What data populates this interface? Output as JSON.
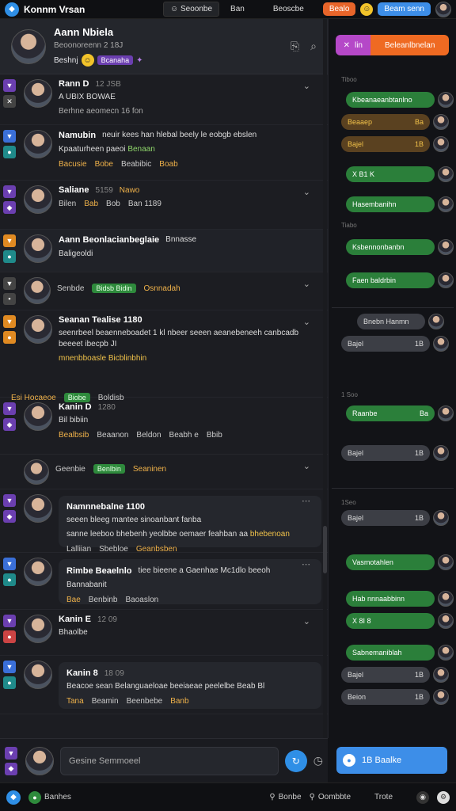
{
  "topbar": {
    "title": "Konnm Vrsan",
    "tabs": [
      "Seoonbe",
      "Ban",
      "Beoscbe"
    ],
    "btn_orange": "Bealo",
    "btn_blue": "Beam senn"
  },
  "channel": {
    "name": "Aann Nbiela",
    "subtitle": "Beoonoreenn 2 18J",
    "status": "Beshnj",
    "tag": "Bcanaha"
  },
  "messages": [
    {
      "name": "Rann D",
      "time": "12 JSB",
      "text": "A UBIX BOWAE",
      "sub": "Berhne aeomecn 16 fon",
      "reacts": []
    },
    {
      "name": "Namubin",
      "time": "",
      "text": "neuir kees han hlebal beely le eobgb ebslen",
      "text2": "Kpaaturheen paeoi",
      "text3": "Benaan",
      "reacts": [
        "Bacusie",
        "Bobe",
        "Beabibic",
        "Boab"
      ]
    },
    {
      "name": "Saliane",
      "time": "5159",
      "time2": "Nawo",
      "text": "",
      "reacts": [
        "Bilen",
        "Bab",
        "Bob",
        "Ban 1189"
      ]
    },
    {
      "name": "Aann Beonlacianbeglaie",
      "time": "",
      "text": "Bnnasse",
      "text2": "Baligeoldi",
      "reacts": []
    },
    {
      "name": "",
      "time": "",
      "text": "",
      "reacts": [
        "Senbde",
        "Bidsb Bidin",
        "Osnnadah"
      ]
    },
    {
      "name": "Seanan Tealise 1180",
      "time": "",
      "text": "seenrbeel beaenneboadet 1 kl nbeer seeen aeanebeneeh canbcadb beeeet ibecpb JI",
      "text2": "mnenbboasle",
      "text3": "Bicblinbhin",
      "reacts": []
    },
    {
      "name": "",
      "time": "",
      "text": "",
      "reacts": [
        "Esi Hocaeoe",
        "Biobe",
        "Boldisb"
      ]
    },
    {
      "name": "Kanin D",
      "time": "1280",
      "text": "Bil bibiin",
      "reacts": [
        "Bealbsib",
        "Beaanon",
        "Beldon",
        "Beabh e",
        "Bbib"
      ]
    },
    {
      "name": "",
      "time": "",
      "text": "",
      "reacts": [
        "Geenbie",
        "Benlbin",
        "Seaninen"
      ]
    },
    {
      "name": "Namnnebalne 1100",
      "time": "",
      "text": "seeen bleeg mantee sinoanbant fanba",
      "text2": "sanne leeboo bhebenh yeolbbe oemaer feahban aa",
      "text3": "bhebenoan",
      "reacts": [
        "Lalliian",
        "Sbebloe",
        "Geanbsben"
      ]
    },
    {
      "name": "Rimbe Beaelnlo",
      "time": "",
      "text": "tiee bieene a Gaenhae Mc1dlo beeoh",
      "text2": "Bannabanit",
      "reacts": [
        "Bae",
        "Benbinb",
        "Baoaslon"
      ]
    },
    {
      "name": "Kanin E",
      "time": "12 09",
      "text": "Bhaolbe",
      "reacts": []
    },
    {
      "name": "Kanin 8",
      "time": "18 09",
      "text": "Beacoe sean Belanguaeloae beeiaeae peelelbe Beab Bl",
      "reacts": [
        "Tana",
        "Beamin",
        "Beenbebe",
        "Banb"
      ]
    }
  ],
  "compose": {
    "placeholder": "Gesine Semmoeel"
  },
  "right": {
    "header_x": "lin",
    "header_btn": "Beleanlbnelan",
    "times": [
      "Tiboo",
      "Tiabo",
      "1 Soo",
      "1Seo"
    ],
    "rows": [
      {
        "label": "Kbeanaeanbtanlno",
        "style": "green"
      },
      {
        "label": "Beaaep",
        "num": "Ba",
        "style": "brown"
      },
      {
        "label": "Bajel",
        "num": "1B",
        "style": "brown"
      },
      {
        "label": "X B1 K",
        "style": "green"
      },
      {
        "label": "Hasembanihn",
        "style": "green"
      },
      {
        "label": "Ksbennonbanbn",
        "style": "green"
      },
      {
        "label": "Faen baldrbin",
        "style": "green"
      },
      {
        "label": "Bnebn Hanmn",
        "style": "gray"
      },
      {
        "label": "Bajel",
        "num": "1B",
        "style": "gray"
      },
      {
        "label": "Raanbe",
        "num": "Ba",
        "style": "green"
      },
      {
        "label": "Bajel",
        "num": "1B",
        "style": "gray"
      },
      {
        "label": "Bajel",
        "num": "1B",
        "style": "gray"
      },
      {
        "label": "Vasmotahlen",
        "style": "green"
      },
      {
        "label": "Hab nnnaabbinn",
        "style": "green"
      },
      {
        "label": "X 8I 8",
        "style": "green"
      },
      {
        "label": "Sabnemaniblah",
        "style": "green"
      },
      {
        "label": "Bajel",
        "num": "1B",
        "style": "gray"
      },
      {
        "label": "Beion",
        "num": "1B",
        "style": "gray"
      }
    ],
    "bottom_btn": "1B Baalke"
  },
  "bottomnav": {
    "item1": "Banhes",
    "item2": "Bonbe",
    "item3": "Oombbte",
    "item4": "Trote"
  }
}
